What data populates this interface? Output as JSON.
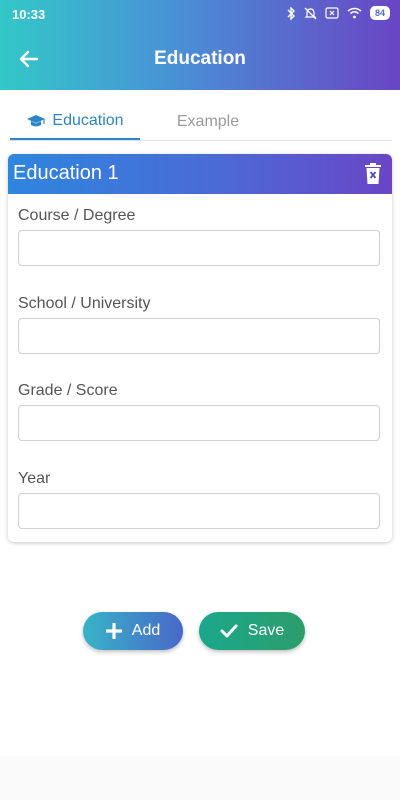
{
  "status_bar": {
    "time": "10:33",
    "battery": "84"
  },
  "header": {
    "title": "Education",
    "back_icon": "arrow-left-icon"
  },
  "tabs": [
    {
      "label": "Education",
      "icon": "graduation-cap-icon",
      "active": true
    },
    {
      "label": "Example",
      "active": false
    }
  ],
  "card": {
    "title": "Education 1",
    "delete_icon": "trash-icon",
    "fields": [
      {
        "label": "Course / Degree",
        "value": "",
        "placeholder": ""
      },
      {
        "label": "School / University",
        "value": "",
        "placeholder": ""
      },
      {
        "label": "Grade / Score",
        "value": "",
        "placeholder": ""
      },
      {
        "label": "Year",
        "value": "",
        "placeholder": ""
      }
    ]
  },
  "actions": {
    "add_label": "Add",
    "save_label": "Save"
  },
  "colors": {
    "header_gradient_start": "#32c8c8",
    "header_gradient_end": "#6a45c4",
    "active_tab": "#2a86c8",
    "add_button": "#4968c8",
    "save_button": "#1aa88c"
  }
}
